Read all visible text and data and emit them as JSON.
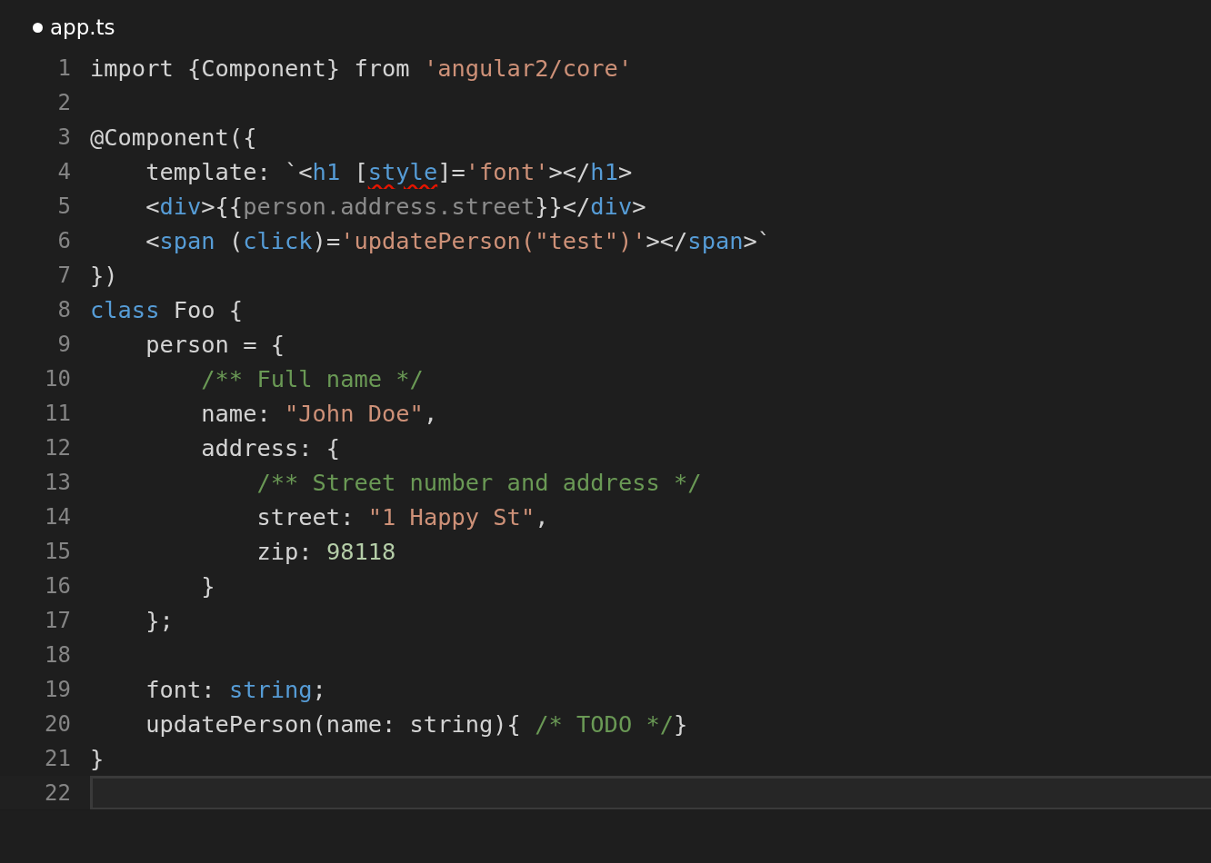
{
  "tab": {
    "title": "app.ts",
    "modified": true
  },
  "lines": [
    {
      "number": "1",
      "current": false,
      "tokens": [
        {
          "kind": "plain",
          "text": "import {Component} from "
        },
        {
          "kind": "string",
          "text": "'angular2/core'"
        }
      ]
    },
    {
      "number": "2",
      "current": false
    },
    {
      "number": "3",
      "current": false,
      "tokens": [
        {
          "kind": "plain",
          "text": "@Component({"
        }
      ]
    },
    {
      "number": "4",
      "current": false,
      "tokens": [
        {
          "kind": "plain",
          "text": "    template: `<"
        },
        {
          "kind": "keyword",
          "text": "h1"
        },
        {
          "kind": "plain",
          "text": " ["
        },
        {
          "kind": "squiggle",
          "text": "style"
        },
        {
          "kind": "plain",
          "text": "]="
        },
        {
          "kind": "string",
          "text": "'font'"
        },
        {
          "kind": "plain",
          "text": "></"
        },
        {
          "kind": "keyword",
          "text": "h1"
        },
        {
          "kind": "plain",
          "text": ">"
        }
      ]
    },
    {
      "number": "5",
      "current": false,
      "tokens": [
        {
          "kind": "plain",
          "text": "    <"
        },
        {
          "kind": "keyword",
          "text": "div"
        },
        {
          "kind": "plain",
          "text": ">{{"
        },
        {
          "kind": "muted",
          "text": "person.address.street"
        },
        {
          "kind": "plain",
          "text": "}}</"
        },
        {
          "kind": "keyword",
          "text": "div"
        },
        {
          "kind": "plain",
          "text": ">"
        }
      ]
    },
    {
      "number": "6",
      "current": false,
      "tokens": [
        {
          "kind": "plain",
          "text": "    <"
        },
        {
          "kind": "keyword",
          "text": "span"
        },
        {
          "kind": "plain",
          "text": " ("
        },
        {
          "kind": "keyword",
          "text": "click"
        },
        {
          "kind": "plain",
          "text": ")="
        },
        {
          "kind": "string",
          "text": "'updatePerson(\"test\")'"
        },
        {
          "kind": "plain",
          "text": "></"
        },
        {
          "kind": "keyword",
          "text": "span"
        },
        {
          "kind": "plain",
          "text": ">`"
        }
      ]
    },
    {
      "number": "7",
      "current": false,
      "tokens": [
        {
          "kind": "plain",
          "text": "})"
        }
      ]
    },
    {
      "number": "8",
      "current": false,
      "tokens": [
        {
          "kind": "keyword",
          "text": "class"
        },
        {
          "kind": "plain",
          "text": " Foo {"
        }
      ]
    },
    {
      "number": "9",
      "current": false,
      "tokens": [
        {
          "kind": "plain",
          "text": "    person = {"
        }
      ]
    },
    {
      "number": "10",
      "current": false,
      "tokens": [
        {
          "kind": "comment",
          "text": "        /** Full name */"
        }
      ]
    },
    {
      "number": "11",
      "current": false,
      "tokens": [
        {
          "kind": "plain",
          "text": "        name: "
        },
        {
          "kind": "string",
          "text": "\"John Doe\""
        },
        {
          "kind": "plain",
          "text": ","
        }
      ]
    },
    {
      "number": "12",
      "current": false,
      "tokens": [
        {
          "kind": "plain",
          "text": "        address: {"
        }
      ]
    },
    {
      "number": "13",
      "current": false,
      "tokens": [
        {
          "kind": "comment",
          "text": "            /** Street number and address */"
        }
      ]
    },
    {
      "number": "14",
      "current": false,
      "tokens": [
        {
          "kind": "plain",
          "text": "            street: "
        },
        {
          "kind": "string",
          "text": "\"1 Happy St\""
        },
        {
          "kind": "plain",
          "text": ","
        }
      ]
    },
    {
      "number": "15",
      "current": false,
      "tokens": [
        {
          "kind": "plain",
          "text": "            zip: "
        },
        {
          "kind": "number",
          "text": "98118"
        }
      ]
    },
    {
      "number": "16",
      "current": false,
      "tokens": [
        {
          "kind": "plain",
          "text": "        }"
        }
      ]
    },
    {
      "number": "17",
      "current": false,
      "tokens": [
        {
          "kind": "plain",
          "text": "    };"
        }
      ]
    },
    {
      "number": "18",
      "current": false
    },
    {
      "number": "19",
      "current": false,
      "tokens": [
        {
          "kind": "plain",
          "text": "    font: "
        },
        {
          "kind": "keyword",
          "text": "string"
        },
        {
          "kind": "plain",
          "text": ";"
        }
      ]
    },
    {
      "number": "20",
      "current": false,
      "tokens": [
        {
          "kind": "plain",
          "text": "    updatePerson(name: string){ "
        },
        {
          "kind": "comment",
          "text": "/* TODO */"
        },
        {
          "kind": "plain",
          "text": "}"
        }
      ]
    },
    {
      "number": "21",
      "current": false,
      "tokens": [
        {
          "kind": "plain",
          "text": "}"
        }
      ]
    },
    {
      "number": "22",
      "current": true
    }
  ]
}
